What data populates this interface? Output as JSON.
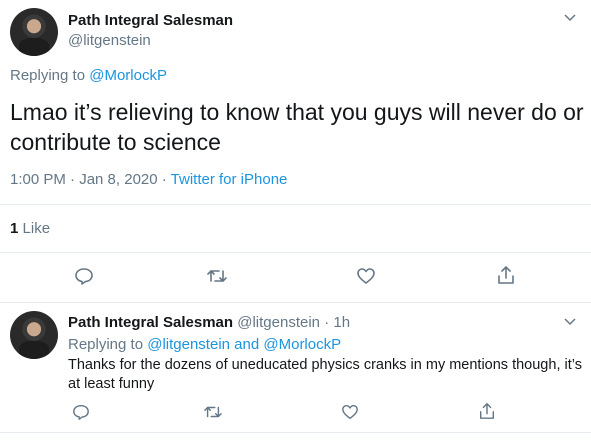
{
  "main_tweet": {
    "author_name": "Path Integral Salesman",
    "author_handle": "@litgenstein",
    "replying_prefix": "Replying to ",
    "replying_to": "@MorlockP",
    "text": "Lmao it’s relieving to know that you guys will never do or contribute to science",
    "timestamp": "1:00 PM · Jan 8, 2020 · ",
    "source": "Twitter for iPhone",
    "like_count": "1",
    "like_label": "Like"
  },
  "reply_tweet": {
    "author_name": "Path Integral Salesman",
    "author_handle": "@litgenstein",
    "separator": "·",
    "time_ago": "1h",
    "replying_prefix": "Replying to ",
    "replying_to_1": "@litgenstein",
    "replying_and": " and ",
    "replying_to_2": "@MorlockP",
    "text": "Thanks for the dozens of uneducated physics cranks in my mentions though, it’s at least funny"
  },
  "icons": {
    "reply": "reply-icon",
    "retweet": "retweet-icon",
    "like": "heart-icon",
    "share": "share-icon",
    "more": "chevron-down-icon"
  },
  "colors": {
    "link": "#1b95e0",
    "muted": "#657786",
    "text": "#14171a",
    "divider": "#e6ecf0"
  }
}
